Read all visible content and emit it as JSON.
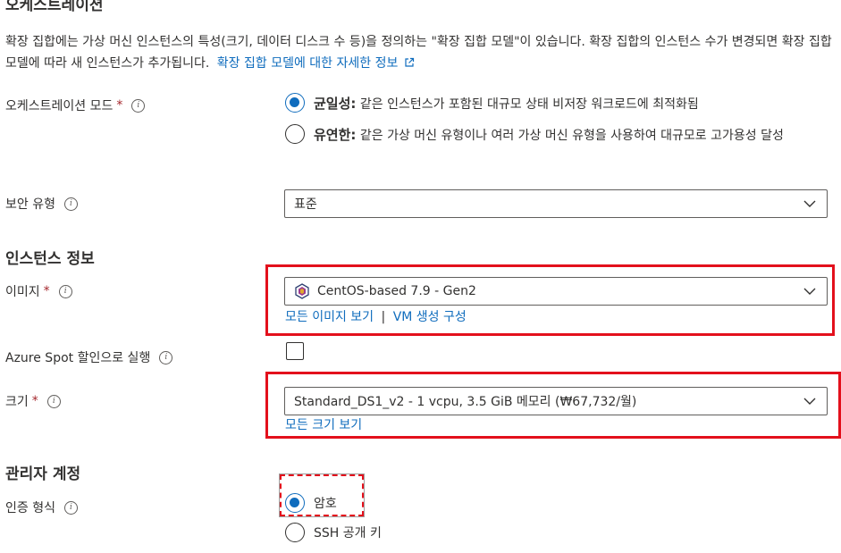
{
  "orchestration": {
    "heading": "오케스트레이션",
    "description": "확장 집합에는 가상 머신 인스턴스의 특성(크기, 데이터 디스크 수 등)을 정의하는 \"확장 집합 모델\"이 있습니다. 확장 집합의 인스턴스 수가 변경되면 확장 집합 모델에 따라 새 인스턴스가 추가됩니다.",
    "learn_more_link": "확장 집합 모델에 대한 자세한 정보",
    "mode_label": "오케스트레이션 모드",
    "options": [
      {
        "title": "균일성:",
        "text": "같은 인스턴스가 포함된 대규모 상태 비저장 워크로드에 최적화됨",
        "selected": true
      },
      {
        "title": "유연한:",
        "text": "같은 가상 머신 유형이나 여러 가상 머신 유형을 사용하여 대규모로 고가용성 달성",
        "selected": false
      }
    ]
  },
  "security": {
    "label": "보안 유형",
    "value": "표준"
  },
  "instance": {
    "heading": "인스턴스 정보",
    "image_label": "이미지",
    "image_value": "CentOS-based 7.9 - Gen2",
    "image_link_all": "모든 이미지 보기",
    "image_link_configure": "VM 생성 구성",
    "spot_label": "Azure Spot 할인으로 실행",
    "spot_checked": false,
    "size_label": "크기",
    "size_value": "Standard_DS1_v2 - 1 vcpu, 3.5 GiB 메모리 (₩67,732/월)",
    "size_link_all": "모든 크기 보기"
  },
  "admin": {
    "heading": "관리자 계정",
    "auth_label": "인증 형식",
    "auth_options": [
      {
        "label": "암호",
        "selected": true
      },
      {
        "label": "SSH 공개 키",
        "selected": false
      }
    ]
  },
  "colors": {
    "accent": "#0f6cbd",
    "highlight_red": "#e3101c",
    "required": "#a4262c"
  }
}
